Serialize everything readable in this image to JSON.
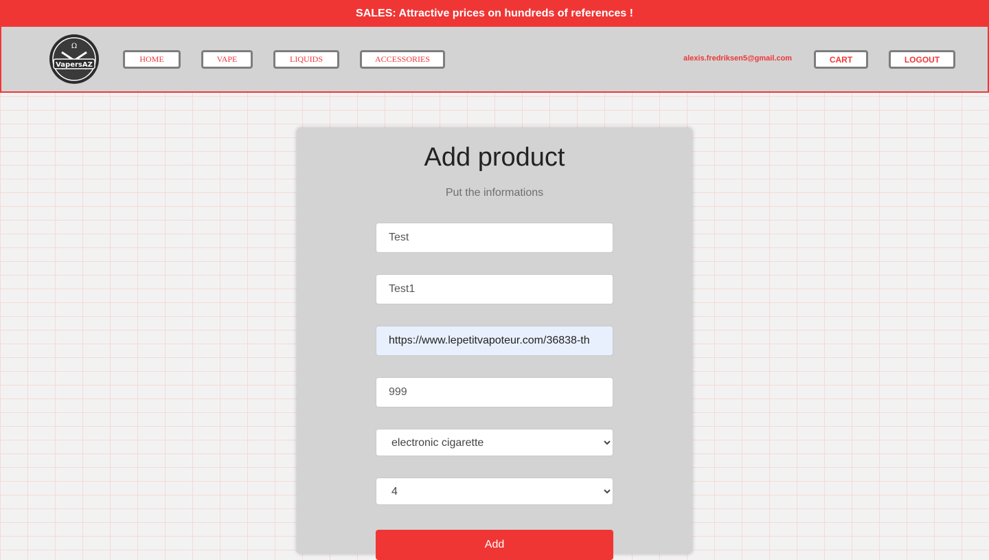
{
  "banner": {
    "text": "SALES: Attractive prices on hundreds of references !"
  },
  "logo": {
    "text": "VapersAZ"
  },
  "nav": {
    "home": "HOME",
    "vape": "VAPE",
    "liquids": "LIQUIDS",
    "accessories": "ACCESSORIES"
  },
  "user": {
    "email": "alexis.fredriksen5@gmail.com",
    "cart": "CART",
    "logout": "LOGOUT"
  },
  "form": {
    "title": "Add product",
    "subtitle": "Put the informations",
    "name_value": "Test",
    "description_value": "Test1",
    "image_url_value": "https://www.lepetitvapoteur.com/36838-th",
    "price_value": "999",
    "category_selected": "electronic cigarette",
    "quantity_selected": "4",
    "submit_label": "Add"
  },
  "colors": {
    "accent": "#ef3635",
    "panel": "#d3d3d3"
  }
}
